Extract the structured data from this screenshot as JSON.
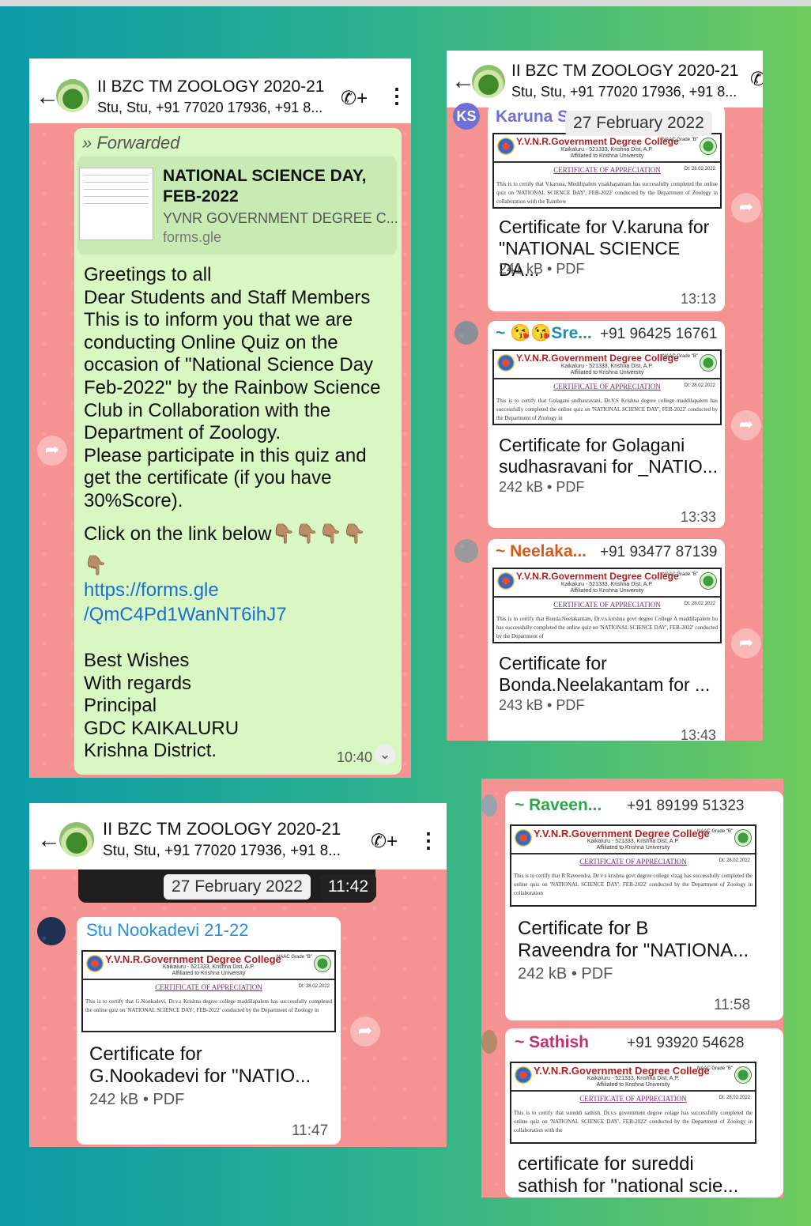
{
  "group": {
    "name": "II BZC TM ZOOLOGY 2020-21",
    "members": "Stu, Stu, +91 77020 17936, +91 8..."
  },
  "icons": {
    "back": "arrow-left-icon",
    "call": "add-call-icon",
    "menu": "more-vertical-icon",
    "forward": "forward-arrow-icon"
  },
  "colors": {
    "chat_background": "#f59292",
    "outgoing_bubble": "#d8f7c3",
    "link": "#1a6fd6"
  },
  "panel1": {
    "forwarded_label": "Forwarded",
    "link_preview": {
      "title": "NATIONAL SCIENCE DAY, FEB-2022",
      "site": "YVNR GOVERNMENT DEGREE C...",
      "domain": "forms.gle"
    },
    "message": "Greetings to all\nDear Students and Staff Members\nThis is to inform you that we are\nconducting Online Quiz on the\noccasion of \"National Science Day\nFeb-2022\" by the Rainbow Science\nClub in Collaboration with the\nDepartment of Zoology.\nPlease participate in this quiz and\nget the certificate (if you have\n30%Score).",
    "click_line": "Click on the link below👇🏽👇🏽👇🏽👇🏽\n👇🏽",
    "link": "https://forms.gle\n/QmC4Pd1WanNT6ihJ7",
    "signature": "Best Wishes\nWith regards\nPrincipal\nGDC KAIKALURU\nKrishna District.",
    "time": "10:40"
  },
  "certificate": {
    "college": "Y.V.N.R.Government Degree College",
    "naac": "NAAC Grade \"B\"",
    "address": "Kaikaluru - 521333, Krishna Dist, A.P.",
    "affiliation": "Affiliated to Krishna University",
    "title": "CERTIFICATE OF APPRECIATION",
    "date": "Dt: 28.02.2022"
  },
  "panel2": {
    "date_pill": "27 February 2022",
    "messages": [
      {
        "sender": "Karuna S",
        "avatar": "KS",
        "phone": "",
        "cert_body": "This is to certify that V.karuna, Modilipalem visakhapatnam has successfully completed the online quiz on 'NATIONAL SCIENCE DAY', FEB-2022' conducted by the Department of Zoology in collaboration with the Rainbow",
        "caption": "Certificate for V.karuna for\n\"NATIONAL SCIENCE DA...",
        "meta": "241 kB • PDF",
        "time": "13:13"
      },
      {
        "sender": "~ 😘😘Sre...",
        "avatar": "",
        "phone": "+91 96425 16761",
        "cert_body": "This is to certify that Golagani sudhasravani, Dr.V.S Krishna degree college maddilapalem has successfully completed the online quiz on 'NATIONAL SCIENCE DAY', FEB-2022' conducted by the Department of Zoology in",
        "caption": "Certificate for Golagani\nsudhasravani for _NATIO...",
        "meta": "242 kB • PDF",
        "time": "13:33"
      },
      {
        "sender": "~ Neelaka...",
        "avatar": "",
        "phone": "+91 93477 87139",
        "cert_body": "This is to certify that Bonda.Neelakantam, Dr.v.s.krishna govt degree College A maddilapalem hu has successfully completed the online quiz on 'NATIONAL SCIENCE DAY', FEB-2022' conducted by the Department of",
        "caption": "Certificate for\nBonda.Neelakantam for ...",
        "meta": "243 kB • PDF",
        "time": "13:43"
      }
    ]
  },
  "panel3": {
    "date_pill": "27 February 2022",
    "time_pill": "11:42",
    "message": {
      "sender": "Stu Nookadevi 21-22",
      "cert_body": "This is to certify that G.Nookadevi, Dr.v.s Krishna degree college maddilapalem has successfully completed the online quiz on 'NATIONAL SCIENCE DAY', FEB-2022' conducted by the Department of Zoology in",
      "caption": "Certificate for\nG.Nookadevi for \"NATIO...",
      "meta": "242 kB • PDF",
      "time": "11:47"
    }
  },
  "panel4": {
    "messages": [
      {
        "sender": "~ Raveen...",
        "phone": "+91 89199 51323",
        "cert_body": "This is to certify that B Raveendra, Dr v s krishna govt degree college vizag has successfully completed the online quiz on 'NATIONAL SCIENCE DAY', FEB-2022' conducted by the Department of Zoology in collaboration",
        "caption": "Certificate for B\nRaveendra for \"NATIONA...",
        "meta": "242 kB • PDF",
        "time": "11:58"
      },
      {
        "sender": "~ Sathish",
        "phone": "+91 93920 54628",
        "cert_body": "This is to certify that sureddi sathish, Dr.v.s government degree colage has successfully completed the online quiz on 'NATIONAL SCIENCE DAY', FEB-2022' conducted by the Department of Zoology in collaboration with the",
        "caption": "certificate for sureddi\nsathish for \"national scie...",
        "meta": "",
        "time": ""
      }
    ]
  }
}
